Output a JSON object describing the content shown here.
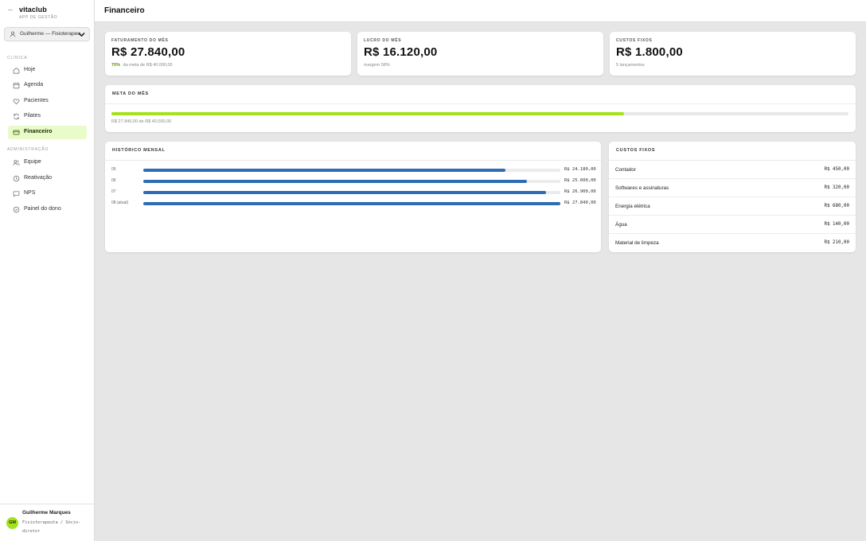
{
  "brand": {
    "name": "vitaclub",
    "subtitle": "APP DE GESTÃO"
  },
  "profile_select": {
    "value": "Guilherme — Fisioterapeuta",
    "icon": "user-icon"
  },
  "nav": {
    "section_clinic": "CLÍNICA",
    "section_admin": "ADMINISTRAÇÃO",
    "items": [
      {
        "label": "Hoje",
        "icon": "home-icon"
      },
      {
        "label": "Agenda",
        "icon": "calendar-icon"
      },
      {
        "label": "Pacientes",
        "icon": "heart-icon"
      },
      {
        "label": "Pilates",
        "icon": "refresh-icon"
      },
      {
        "label": "Financeiro",
        "icon": "card-icon",
        "active": true
      },
      {
        "label": "Equipe",
        "icon": "users-icon"
      },
      {
        "label": "Reativação",
        "icon": "clock-icon"
      },
      {
        "label": "NPS",
        "icon": "chat-icon"
      },
      {
        "label": "Painel do dono",
        "icon": "shield-icon"
      }
    ]
  },
  "user": {
    "initials": "GM",
    "name": "Guilherme Marques",
    "role": "Fisioterapeuta / Sócio-diretor"
  },
  "page": {
    "title": "Financeiro"
  },
  "kpis": {
    "revenue": {
      "label": "FATURAMENTO DO MÊS",
      "value": "R$ 27.840,00",
      "percent": "70%",
      "note": "da meta de R$ 40.000,00"
    },
    "profit": {
      "label": "LUCRO DO MÊS",
      "value": "R$ 16.120,00",
      "note": "margem 58%"
    },
    "fixed": {
      "label": "CUSTOS FIXOS",
      "value": "R$ 1.800,00",
      "note": "5 lançamentos"
    }
  },
  "goal": {
    "title": "META DO MÊS",
    "progress": 0.696,
    "caption": "R$ 27.840,00 de R$ 40.000,00",
    "color": "#a3e21c"
  },
  "history": {
    "title": "HISTÓRICO MENSAL",
    "bar_color": "#2f6cb4",
    "rows": [
      {
        "label": "05",
        "amount": 24180,
        "value": "R$ 24.180,00"
      },
      {
        "label": "06",
        "amount": 25600,
        "value": "R$ 25.600,00"
      },
      {
        "label": "07",
        "amount": 26900,
        "value": "R$ 26.900,00"
      },
      {
        "label": "08 (atual)",
        "amount": 27840,
        "value": "R$ 27.840,00"
      }
    ]
  },
  "fixed_costs": {
    "title": "CUSTOS FIXOS",
    "rows": [
      {
        "name": "Contador",
        "value": "R$ 450,00"
      },
      {
        "name": "Softwares e assinaturas",
        "value": "R$ 320,00"
      },
      {
        "name": "Energia elétrica",
        "value": "R$ 680,00"
      },
      {
        "name": "Água",
        "value": "R$ 140,00"
      },
      {
        "name": "Material de limpeza",
        "value": "R$ 210,00"
      }
    ]
  }
}
